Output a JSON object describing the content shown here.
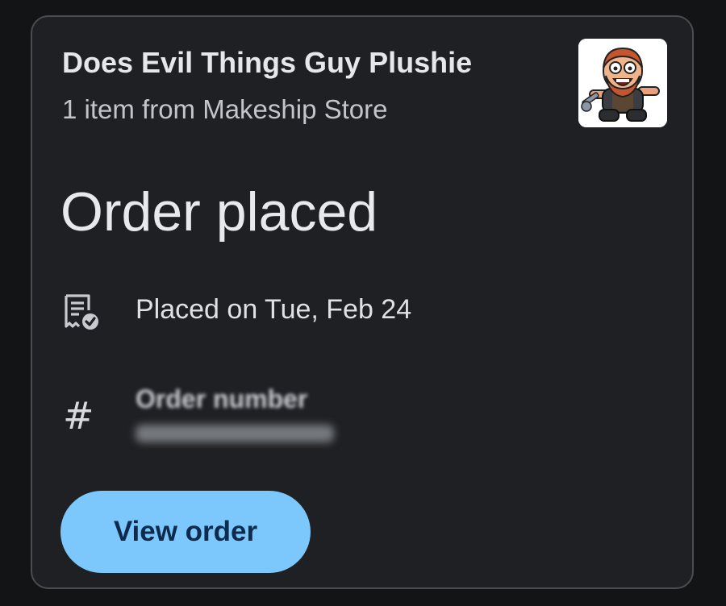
{
  "product": {
    "title": "Does Evil Things Guy Plushie",
    "subtitle": "1 item from Makeship Store"
  },
  "order": {
    "status": "Order placed",
    "placed_text": "Placed on Tue, Feb 24",
    "number_label": "Order number",
    "number_value": "",
    "hash_symbol": "#"
  },
  "actions": {
    "view_order_label": "View order"
  },
  "icons": {
    "receipt": "receipt-check-icon",
    "hash": "hash-icon",
    "thumbnail": "plushie-thumbnail"
  },
  "colors": {
    "background": "#131415",
    "card": "#1e2023",
    "button": "#7cc8fd",
    "button_text": "#0e2a4d"
  }
}
